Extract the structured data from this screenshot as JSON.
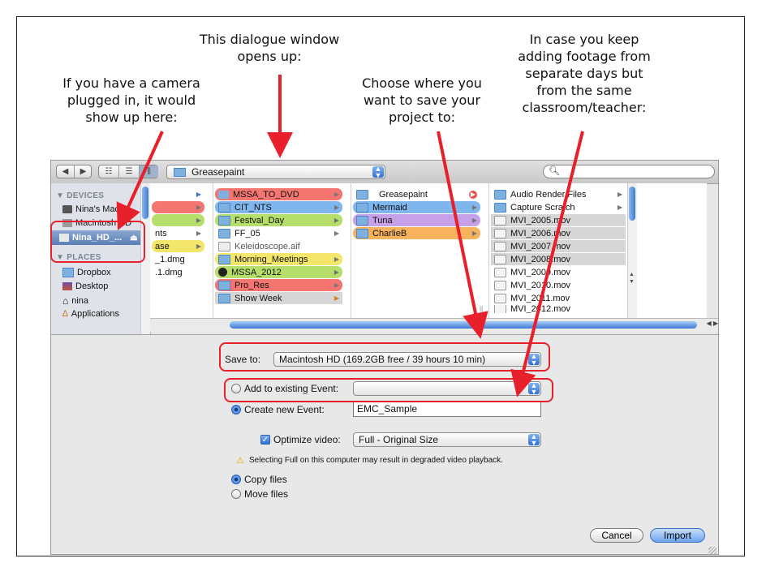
{
  "annotations": {
    "camera": [
      "If you have a camera",
      "plugged in, it would",
      "show up here:"
    ],
    "dialog": [
      "This dialogue window",
      "opens up:"
    ],
    "save": [
      "Choose where you",
      "want to save your",
      "project to:"
    ],
    "footage": [
      "In case you keep",
      "adding footage from",
      "separate days but",
      "from the same",
      "classroom/teacher:"
    ]
  },
  "toolbar": {
    "back": "◀",
    "forward": "▶",
    "location": "Greasepaint",
    "search_placeholder": ""
  },
  "sidebar": {
    "devices_header": "▼ DEVICES",
    "devices": [
      "Nina's MacBo...",
      "Macintosh HD",
      "Nina_HD_..."
    ],
    "places_header": "▼ PLACES",
    "places": [
      "Dropbox",
      "Desktop",
      "nina",
      "Applications"
    ]
  },
  "columns": {
    "col1": [
      "",
      "",
      "nts",
      "ase",
      "_1.dmg",
      ".1.dmg"
    ],
    "col2": [
      "MSSA_TO_DVD",
      "CIT_NTS",
      "Festval_Day",
      "FF_05",
      "Keleidoscope.aif",
      "Morning_Meetings",
      "MSSA_2012",
      "Pro_Res",
      "Show Week"
    ],
    "col3": [
      "Greasepaint",
      "Mermaid",
      "Tuna",
      "CharlieB"
    ],
    "col4": [
      "Audio Render Files",
      "Capture Scratch",
      "MVI_2005.mov",
      "MVI_2006.mov",
      "MVI_2007.mov",
      "MVI_2008.mov",
      "MVI_2009.mov",
      "MVI_2010.mov",
      "MVI_2011.mov",
      "MVI_2012.mov"
    ]
  },
  "form": {
    "save_to_label": "Save to:",
    "save_to_value": "Macintosh HD (169.2GB free / 39 hours 10 min)",
    "add_existing_label": "Add to existing Event:",
    "add_existing_value": "",
    "create_new_label": "Create new Event:",
    "create_new_value": "EMC_Sample",
    "optimize_label": "Optimize video:",
    "optimize_value": "Full - Original Size",
    "warning": "Selecting Full on this computer may result in degraded video playback.",
    "copy_files": "Copy files",
    "move_files": "Move files"
  },
  "buttons": {
    "cancel": "Cancel",
    "import": "Import"
  },
  "colors": {
    "annotation_red": "#e8202b",
    "select_blue": "#2f6fd6"
  }
}
